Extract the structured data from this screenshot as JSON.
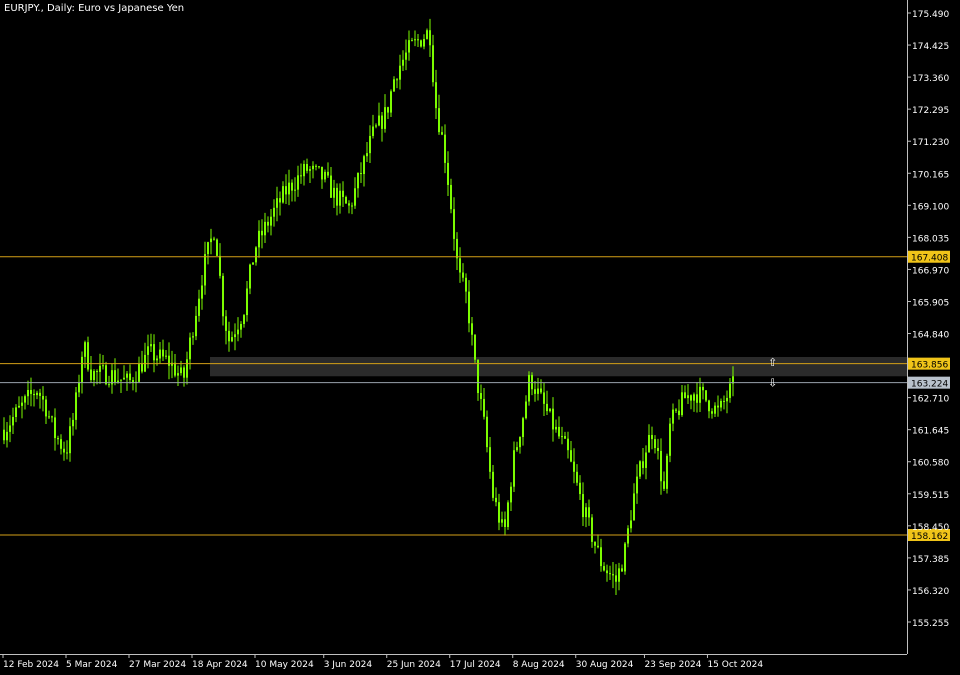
{
  "window": {
    "title": "EURJPY., Daily:  Euro vs Japanese Yen"
  },
  "colors": {
    "background": "#000000",
    "candle": "#7CFC00",
    "axis": "#c0c0c0",
    "text": "#ffffff",
    "level_line": "#d4a017",
    "level_label_bg": "#f0c419",
    "current_line": "#9aa3ad",
    "current_label_bg": "#b9c2cc",
    "zone_fill": "#2b2b2b"
  },
  "price_axis": {
    "labels": [
      "175.490",
      "174.425",
      "173.360",
      "172.295",
      "171.230",
      "170.165",
      "169.100",
      "168.035",
      "166.970",
      "165.905",
      "164.840",
      "162.710",
      "161.645",
      "160.580",
      "159.515",
      "158.450",
      "157.385",
      "156.320",
      "155.255"
    ]
  },
  "time_axis": {
    "labels": [
      "12 Feb 2024",
      "5 Mar 2024",
      "27 Mar 2024",
      "18 Apr 2024",
      "10 May 2024",
      "3 Jun 2024",
      "25 Jun 2024",
      "17 Jul 2024",
      "8 Aug 2024",
      "30 Aug 2024",
      "23 Sep 2024",
      "15 Oct 2024"
    ]
  },
  "levels": [
    {
      "price": 167.408,
      "label": "167.408"
    },
    {
      "price": 163.856,
      "label": "163.856"
    },
    {
      "price": 158.162,
      "label": "158.162"
    }
  ],
  "current_price": {
    "price": 163.224,
    "label": "163.224"
  },
  "zone": {
    "top_price": 164.06,
    "bottom_price": 163.42,
    "up_icon": "up-arrow-icon",
    "down_icon": "down-arrow-icon"
  },
  "chart_data": {
    "type": "candlestick",
    "title": "EURJPY., Daily:  Euro vs Japanese Yen",
    "ylim": [
      154.95,
      175.7
    ],
    "x": [
      "12 Feb 2024",
      "5 Mar 2024",
      "27 Mar 2024",
      "18 Apr 2024",
      "10 May 2024",
      "3 Jun 2024",
      "25 Jun 2024",
      "17 Jul 2024",
      "8 Aug 2024",
      "30 Aug 2024",
      "23 Sep 2024",
      "15 Oct 2024"
    ],
    "close_path": [
      [
        "12 Feb 2024",
        161.6
      ],
      [
        "16 Feb 2024",
        162.1
      ],
      [
        "21 Feb 2024",
        162.7
      ],
      [
        "24 Feb 2024",
        163.0
      ],
      [
        "27 Feb 2024",
        162.4
      ],
      [
        "1 Mar 2024",
        161.5
      ],
      [
        "5 Mar 2024",
        160.9
      ],
      [
        "8 Mar 2024",
        162.2
      ],
      [
        "11 Mar 2024",
        164.5
      ],
      [
        "14 Mar 2024",
        163.5
      ],
      [
        "20 Mar 2024",
        163.5
      ],
      [
        "27 Mar 2024",
        163.2
      ],
      [
        "3 Apr 2024",
        164.2
      ],
      [
        "10 Apr 2024",
        163.9
      ],
      [
        "15 Apr 2024",
        163.3
      ],
      [
        "18 Apr 2024",
        164.9
      ],
      [
        "22 Apr 2024",
        167.0
      ],
      [
        "26 Apr 2024",
        168.4
      ],
      [
        "29 Apr 2024",
        165.5
      ],
      [
        "1 May 2024",
        164.6
      ],
      [
        "6 May 2024",
        165.6
      ],
      [
        "10 May 2024",
        167.7
      ],
      [
        "16 May 2024",
        168.8
      ],
      [
        "21 May 2024",
        169.6
      ],
      [
        "28 May 2024",
        170.3
      ],
      [
        "3 Jun 2024",
        170.0
      ],
      [
        "7 Jun 2024",
        169.4
      ],
      [
        "12 Jun 2024",
        169.0
      ],
      [
        "17 Jun 2024",
        170.5
      ],
      [
        "20 Jun 2024",
        171.4
      ],
      [
        "25 Jun 2024",
        172.2
      ],
      [
        "28 Jun 2024",
        173.5
      ],
      [
        "3 Jul 2024",
        174.3
      ],
      [
        "10 Jul 2024",
        174.9
      ],
      [
        "12 Jul 2024",
        172.5
      ],
      [
        "15 Jul 2024",
        171.0
      ],
      [
        "17 Jul 2024",
        169.5
      ],
      [
        "20 Jul 2024",
        166.8
      ],
      [
        "23 Jul 2024",
        166.0
      ],
      [
        "26 Jul 2024",
        163.6
      ],
      [
        "29 Jul 2024",
        161.8
      ],
      [
        "1 Aug 2024",
        159.5
      ],
      [
        "5 Aug 2024",
        158.1
      ],
      [
        "8 Aug 2024",
        160.5
      ],
      [
        "12 Aug 2024",
        162.3
      ],
      [
        "14 Aug 2024",
        163.4
      ],
      [
        "19 Aug 2024",
        162.4
      ],
      [
        "23 Aug 2024",
        161.6
      ],
      [
        "27 Aug 2024",
        160.9
      ],
      [
        "30 Aug 2024",
        159.9
      ],
      [
        "3 Sep 2024",
        158.6
      ],
      [
        "8 Sep 2024",
        157.2
      ],
      [
        "13 Sep 2024",
        156.6
      ],
      [
        "16 Sep 2024",
        157.5
      ],
      [
        "19 Sep 2024",
        159.3
      ],
      [
        "23 Sep 2024",
        160.9
      ],
      [
        "26 Sep 2024",
        161.7
      ],
      [
        "30 Sep 2024",
        159.5
      ],
      [
        "2 Oct 2024",
        161.8
      ],
      [
        "7 Oct 2024",
        162.7
      ],
      [
        "11 Oct 2024",
        162.9
      ],
      [
        "15 Oct 2024",
        162.6
      ],
      [
        "19 Oct 2024",
        162.2
      ],
      [
        "22 Oct 2024",
        162.8
      ],
      [
        "24 Oct 2024",
        163.1
      ]
    ]
  }
}
